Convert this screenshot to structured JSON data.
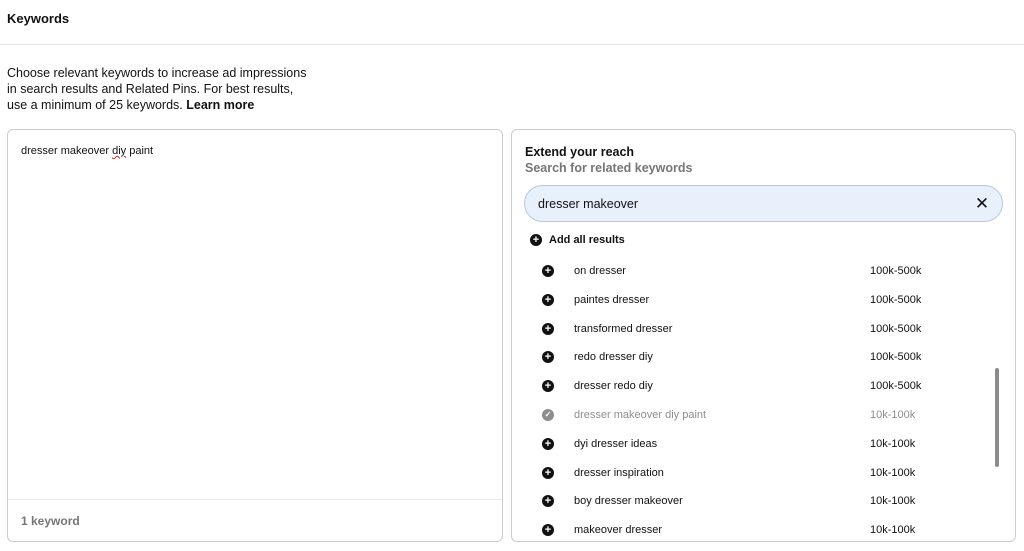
{
  "header": {
    "title": "Keywords"
  },
  "description": {
    "text": "Choose relevant keywords to increase ad impressions in search results and Related Pins. For best results, use a minimum of 25 keywords.",
    "link": "Learn more"
  },
  "keywords_panel": {
    "entry_text_part1": "dresser makeover ",
    "entry_text_spell": "diy",
    "entry_text_part2": " paint",
    "count": "1 keyword"
  },
  "extend_panel": {
    "title": "Extend your reach",
    "subtitle": "Search for related keywords",
    "search_value": "dresser makeover",
    "clear_icon": "close-icon",
    "add_all_label": "Add all results",
    "results": [
      {
        "label": "on dresser",
        "volume": "100k-500k",
        "state": "add"
      },
      {
        "label": "paintes dresser",
        "volume": "100k-500k",
        "state": "add"
      },
      {
        "label": "transformed dresser",
        "volume": "100k-500k",
        "state": "add"
      },
      {
        "label": "redo dresser diy",
        "volume": "100k-500k",
        "state": "add"
      },
      {
        "label": "dresser redo diy",
        "volume": "100k-500k",
        "state": "add"
      },
      {
        "label": "dresser makeover diy paint",
        "volume": "10k-100k",
        "state": "added"
      },
      {
        "label": "dyi dresser ideas",
        "volume": "10k-100k",
        "state": "add"
      },
      {
        "label": "dresser inspiration",
        "volume": "10k-100k",
        "state": "add"
      },
      {
        "label": "boy dresser makeover",
        "volume": "10k-100k",
        "state": "add"
      },
      {
        "label": "makeover dresser",
        "volume": "10k-100k",
        "state": "add"
      }
    ]
  }
}
